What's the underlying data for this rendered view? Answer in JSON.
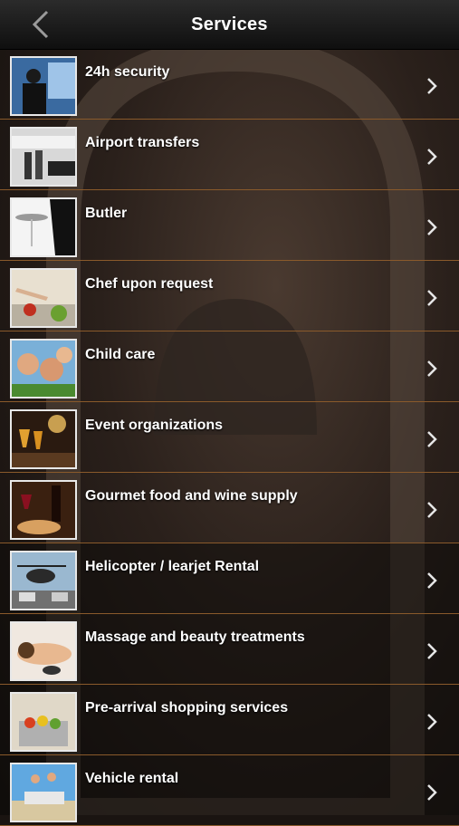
{
  "header": {
    "title": "Services"
  },
  "icons": {
    "back": "chevron-left-icon",
    "row": "chevron-right-icon"
  },
  "colors": {
    "divider": "#8a5a2b",
    "header": "#1a1a1a",
    "text": "#ffffff"
  },
  "services": [
    {
      "label": "24h security",
      "thumb": "security-thumbnail"
    },
    {
      "label": "Airport transfers",
      "thumb": "airport-transfer-thumbnail"
    },
    {
      "label": "Butler",
      "thumb": "butler-thumbnail"
    },
    {
      "label": "Chef upon request",
      "thumb": "chef-thumbnail"
    },
    {
      "label": "Child care",
      "thumb": "child-care-thumbnail"
    },
    {
      "label": "Event organizations",
      "thumb": "event-thumbnail"
    },
    {
      "label": "Gourmet food and wine supply",
      "thumb": "gourmet-food-thumbnail"
    },
    {
      "label": "Helicopter / learjet Rental",
      "thumb": "helicopter-thumbnail"
    },
    {
      "label": "Massage and beauty treatments",
      "thumb": "massage-thumbnail"
    },
    {
      "label": "Pre-arrival shopping services",
      "thumb": "shopping-thumbnail"
    },
    {
      "label": "Vehicle rental",
      "thumb": "vehicle-rental-thumbnail"
    }
  ]
}
